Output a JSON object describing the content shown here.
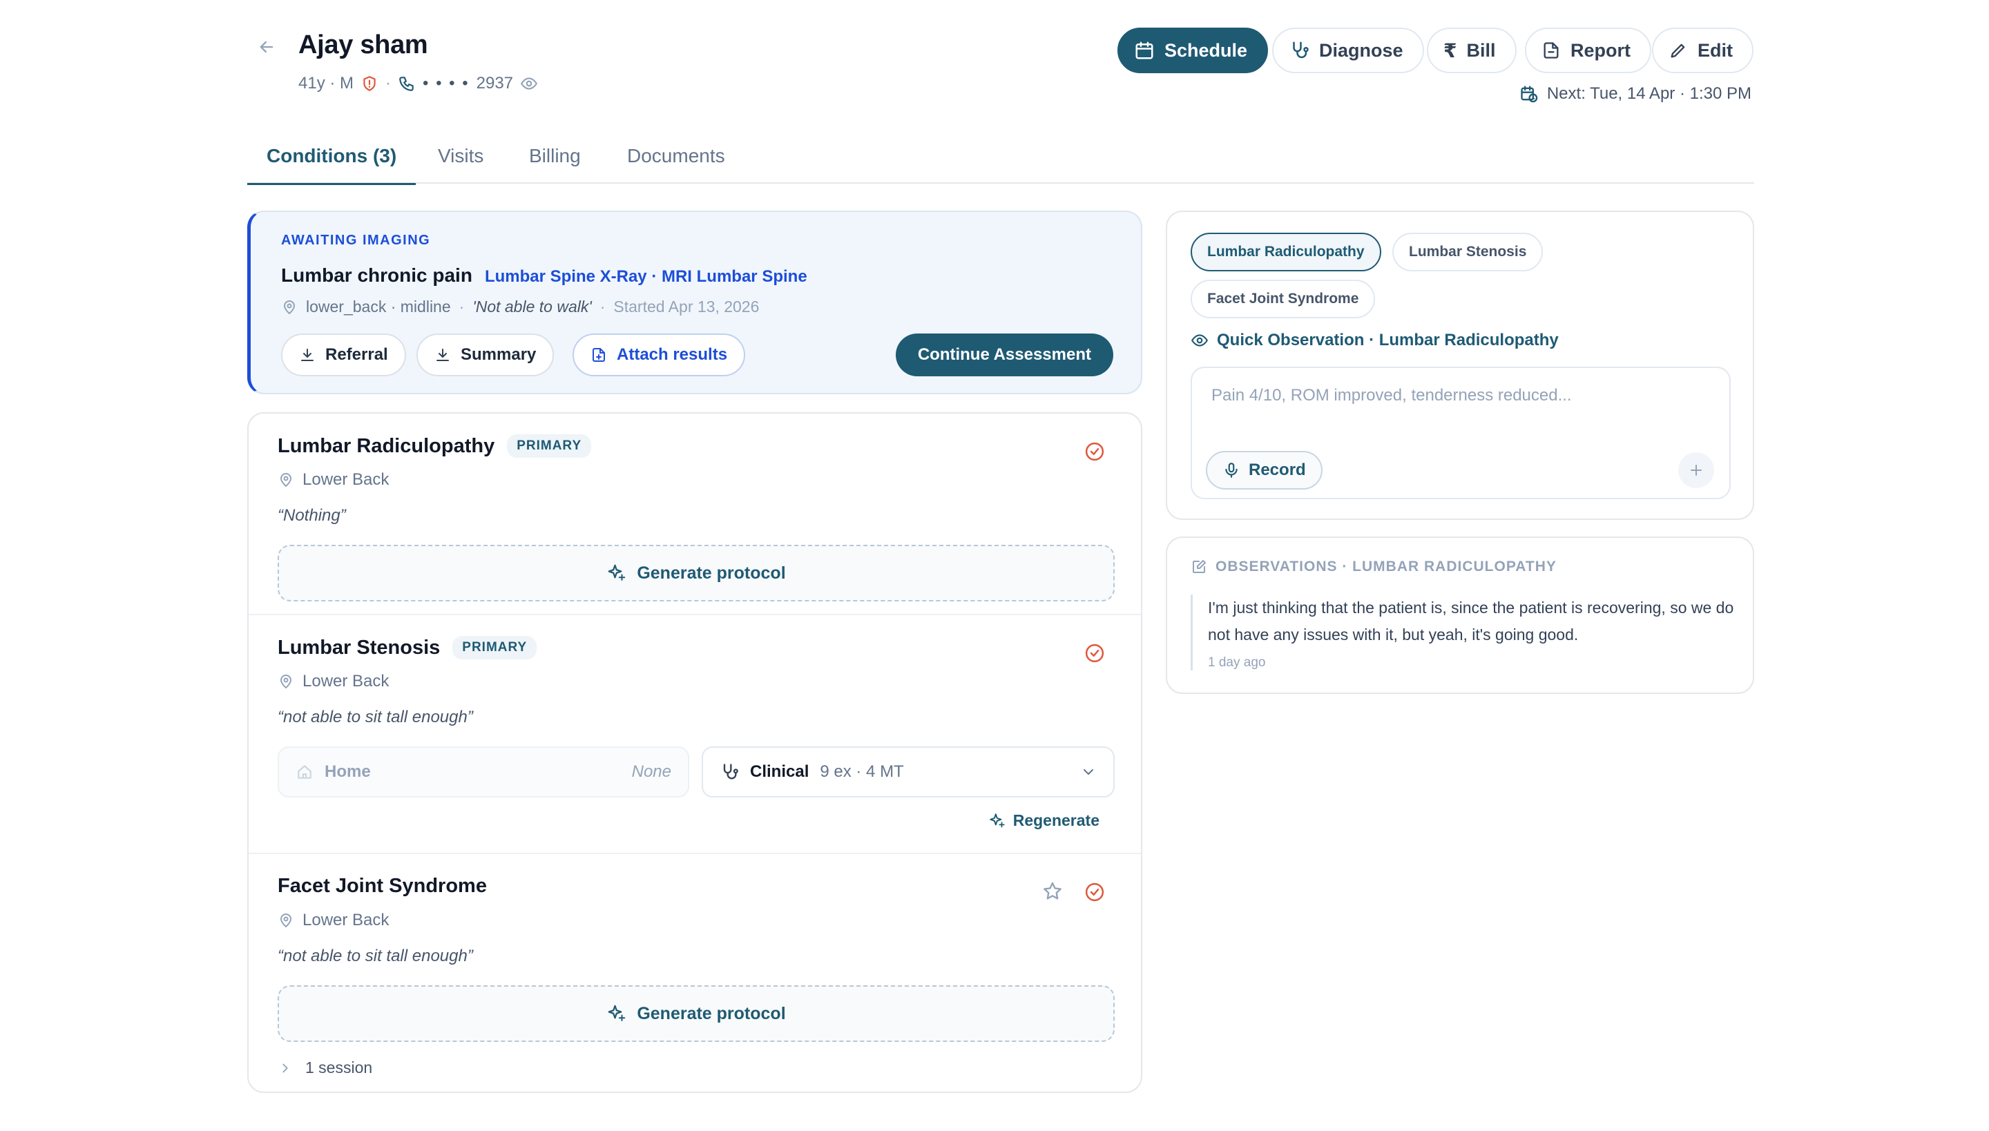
{
  "patient": {
    "name": "Ajay sham",
    "age_sex": "41y · M",
    "phone_mask": "• • • •",
    "phone_last": "2937",
    "next_appointment": "Next: Tue, 14 Apr · 1:30 PM"
  },
  "header_actions": {
    "schedule": "Schedule",
    "diagnose": "Diagnose",
    "bill": "Bill",
    "report": "Report",
    "edit": "Edit"
  },
  "tabs": [
    "Conditions (3)",
    "Visits",
    "Billing",
    "Documents"
  ],
  "awaiting": {
    "tag": "AWAITING IMAGING",
    "title": "Lumbar chronic pain",
    "imaging": "Lumbar Spine X-Ray · MRI Lumbar Spine",
    "location": "lower_back · midline",
    "quote": "'Not able to walk'",
    "started": "Started Apr 13, 2026",
    "referral": "Referral",
    "summary": "Summary",
    "attach": "Attach results",
    "continue": "Continue Assessment"
  },
  "conditions": [
    {
      "name": "Lumbar Radiculopathy",
      "badge": "PRIMARY",
      "location": "Lower Back",
      "quote": "“Nothing”",
      "action": "Generate protocol"
    },
    {
      "name": "Lumbar Stenosis",
      "badge": "PRIMARY",
      "location": "Lower Back",
      "quote": "“not able to sit tall enough”",
      "home_label": "Home",
      "home_value": "None",
      "clinical_label": "Clinical",
      "clinical_meta": "9 ex · 4 MT",
      "regenerate": "Regenerate"
    },
    {
      "name": "Facet Joint Syndrome",
      "location": "Lower Back",
      "quote": "“not able to sit tall enough”",
      "action": "Generate protocol",
      "sessions": "1 session"
    }
  ],
  "quick_observation": {
    "chips": [
      "Lumbar Radiculopathy",
      "Lumbar Stenosis",
      "Facet Joint Syndrome"
    ],
    "title": "Quick Observation · Lumbar Radiculopathy",
    "placeholder": "Pain 4/10, ROM improved, tenderness reduced...",
    "record": "Record"
  },
  "observations": {
    "title": "OBSERVATIONS · LUMBAR RADICULOPATHY",
    "text": "I'm just thinking that the patient is, since the patient is recovering, so we do not have any issues with it, but yeah, it's going good.",
    "time": "1 day ago"
  },
  "colors": {
    "primary": "#1f5a73",
    "link_blue": "#1d4ed8",
    "check_red": "#e0573c"
  }
}
